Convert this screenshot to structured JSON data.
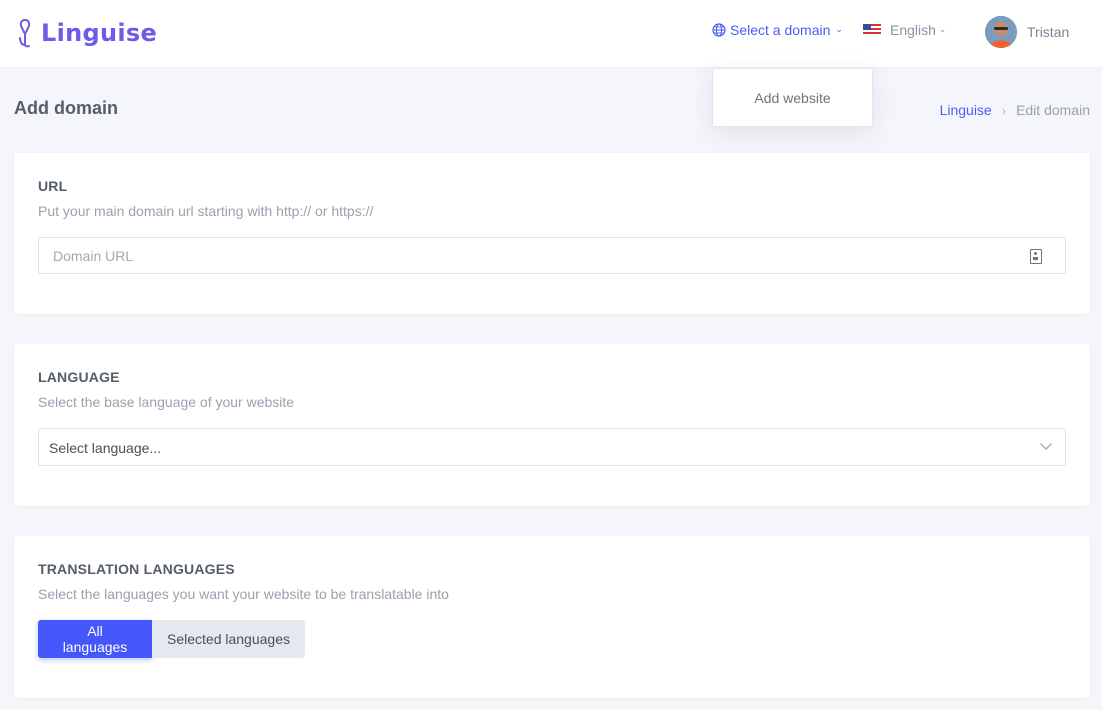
{
  "brand": {
    "name": "Linguise",
    "color": "#6c5ce7"
  },
  "topbar": {
    "domain_selector": {
      "label": "Select a domain",
      "icon": "globe-icon"
    },
    "language_selector": {
      "label": "English",
      "flag": "us-flag-icon"
    },
    "user": {
      "name": "Tristan"
    }
  },
  "dropdown": {
    "items": [
      {
        "label": "Add website"
      }
    ]
  },
  "page": {
    "title": "Add domain",
    "breadcrumb": {
      "root": "Linguise",
      "separator": "›",
      "current": "Edit domain"
    }
  },
  "sections": {
    "url": {
      "title": "URL",
      "description": "Put your main domain url starting with http:// or https://",
      "input_placeholder": "Domain URL",
      "input_value": ""
    },
    "language": {
      "title": "LANGUAGE",
      "description": "Select the base language of your website",
      "select_value": "Select language..."
    },
    "translation": {
      "title": "TRANSLATION LANGUAGES",
      "description": "Select the languages you want your website to be translatable into",
      "options": [
        "All languages",
        "Selected languages"
      ],
      "selected": "All languages"
    }
  },
  "colors": {
    "accent": "#4557fb",
    "link": "#4c5cf5",
    "background": "#f5f6fb"
  }
}
